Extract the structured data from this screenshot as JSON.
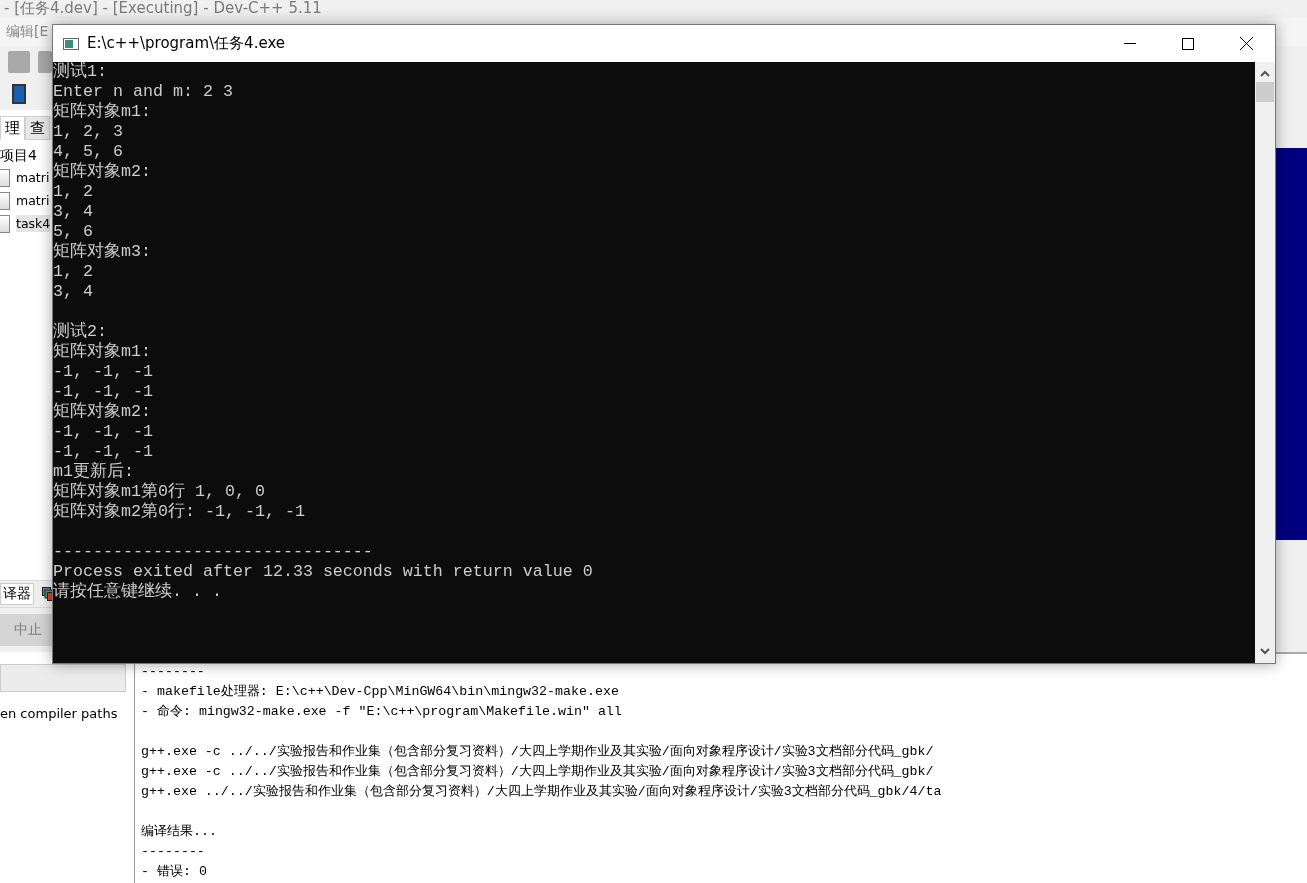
{
  "ide_window": {
    "title": "- [任务4.dev] - [Executing] - Dev-C++ 5.11",
    "menu": [
      "编辑[E"
    ],
    "tabs": [
      {
        "label": "理",
        "selected": true
      },
      {
        "label": "查",
        "selected": false
      }
    ],
    "project_tree": {
      "label": "项目4",
      "children": [
        {
          "label": "matri",
          "selected": false
        },
        {
          "label": "matri",
          "selected": false
        },
        {
          "label": "task4",
          "selected": true
        }
      ]
    },
    "bottom_tabs": [
      {
        "label": "译器",
        "selected": true
      }
    ],
    "abort_button": {
      "label": "中止",
      "disabled": true
    },
    "option_label": "en compiler paths",
    "compile_log": [
      [
        "--------",
        "- makefile处理器: E:\\c++\\Dev-Cpp\\MinGW64\\bin\\mingw32-make.exe",
        "- 命令: mingw32-make.exe -f \"E:\\c++\\program\\Makefile.win\" all"
      ],
      [
        "g++.exe -c ../../实验报告和作业集（包含部分复习资料）/大四上学期作业及其实验/面向对象程序设计/实验3文档部分代码_gbk/",
        "g++.exe -c ../../实验报告和作业集（包含部分复习资料）/大四上学期作业及其实验/面向对象程序设计/实验3文档部分代码_gbk/",
        "g++.exe ../../实验报告和作业集（包含部分复习资料）/大四上学期作业及其实验/面向对象程序设计/实验3文档部分代码_gbk/4/ta"
      ],
      [
        "编译结果...",
        "--------",
        "- 错误: 0"
      ]
    ]
  },
  "console_window": {
    "title": "E:\\c++\\program\\任务4.exe",
    "sections": [
      [
        "测试1:",
        "Enter n and m: 2 3",
        "矩阵对象m1:",
        "1, 2, 3",
        "4, 5, 6",
        "矩阵对象m2:",
        "1, 2",
        "3, 4",
        "5, 6",
        "矩阵对象m3:",
        "1, 2",
        "3, 4"
      ],
      [
        "测试2:",
        "矩阵对象m1:",
        "-1, -1, -1",
        "-1, -1, -1",
        "矩阵对象m2:",
        "-1, -1, -1",
        "-1, -1, -1",
        "m1更新后:",
        "矩阵对象m1第0行 1, 0, 0",
        "矩阵对象m2第0行: -1, -1, -1"
      ],
      [
        "--------------------------------",
        "Process exited after 12.33 seconds with return value 0",
        "请按任意键继续. . ."
      ]
    ]
  }
}
